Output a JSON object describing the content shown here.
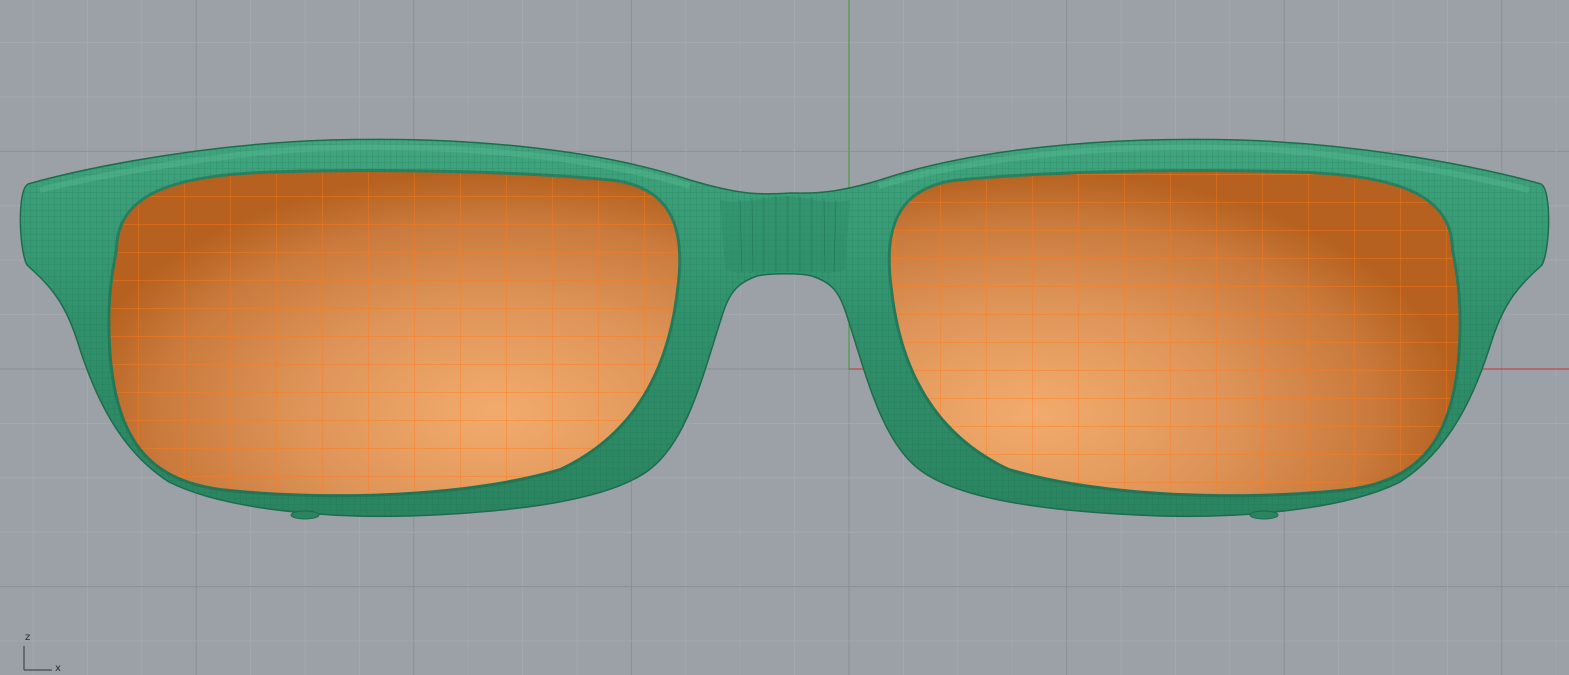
{
  "viewport": {
    "axis_labels": {
      "z": "z",
      "x": "x"
    },
    "colors": {
      "background": "#9ca1a7",
      "grid_minor": "#a7abb0",
      "grid_major": "#8c9096",
      "world_axis_y": "#4f9a4a",
      "world_axis_x": "#b84a4a",
      "frame": "#2f8f6b",
      "frame_wire": "#1f6b4d",
      "lens_light": "#f2a86a",
      "lens_dark": "#b85f20",
      "lens_wire": "#ff7a1a"
    }
  }
}
